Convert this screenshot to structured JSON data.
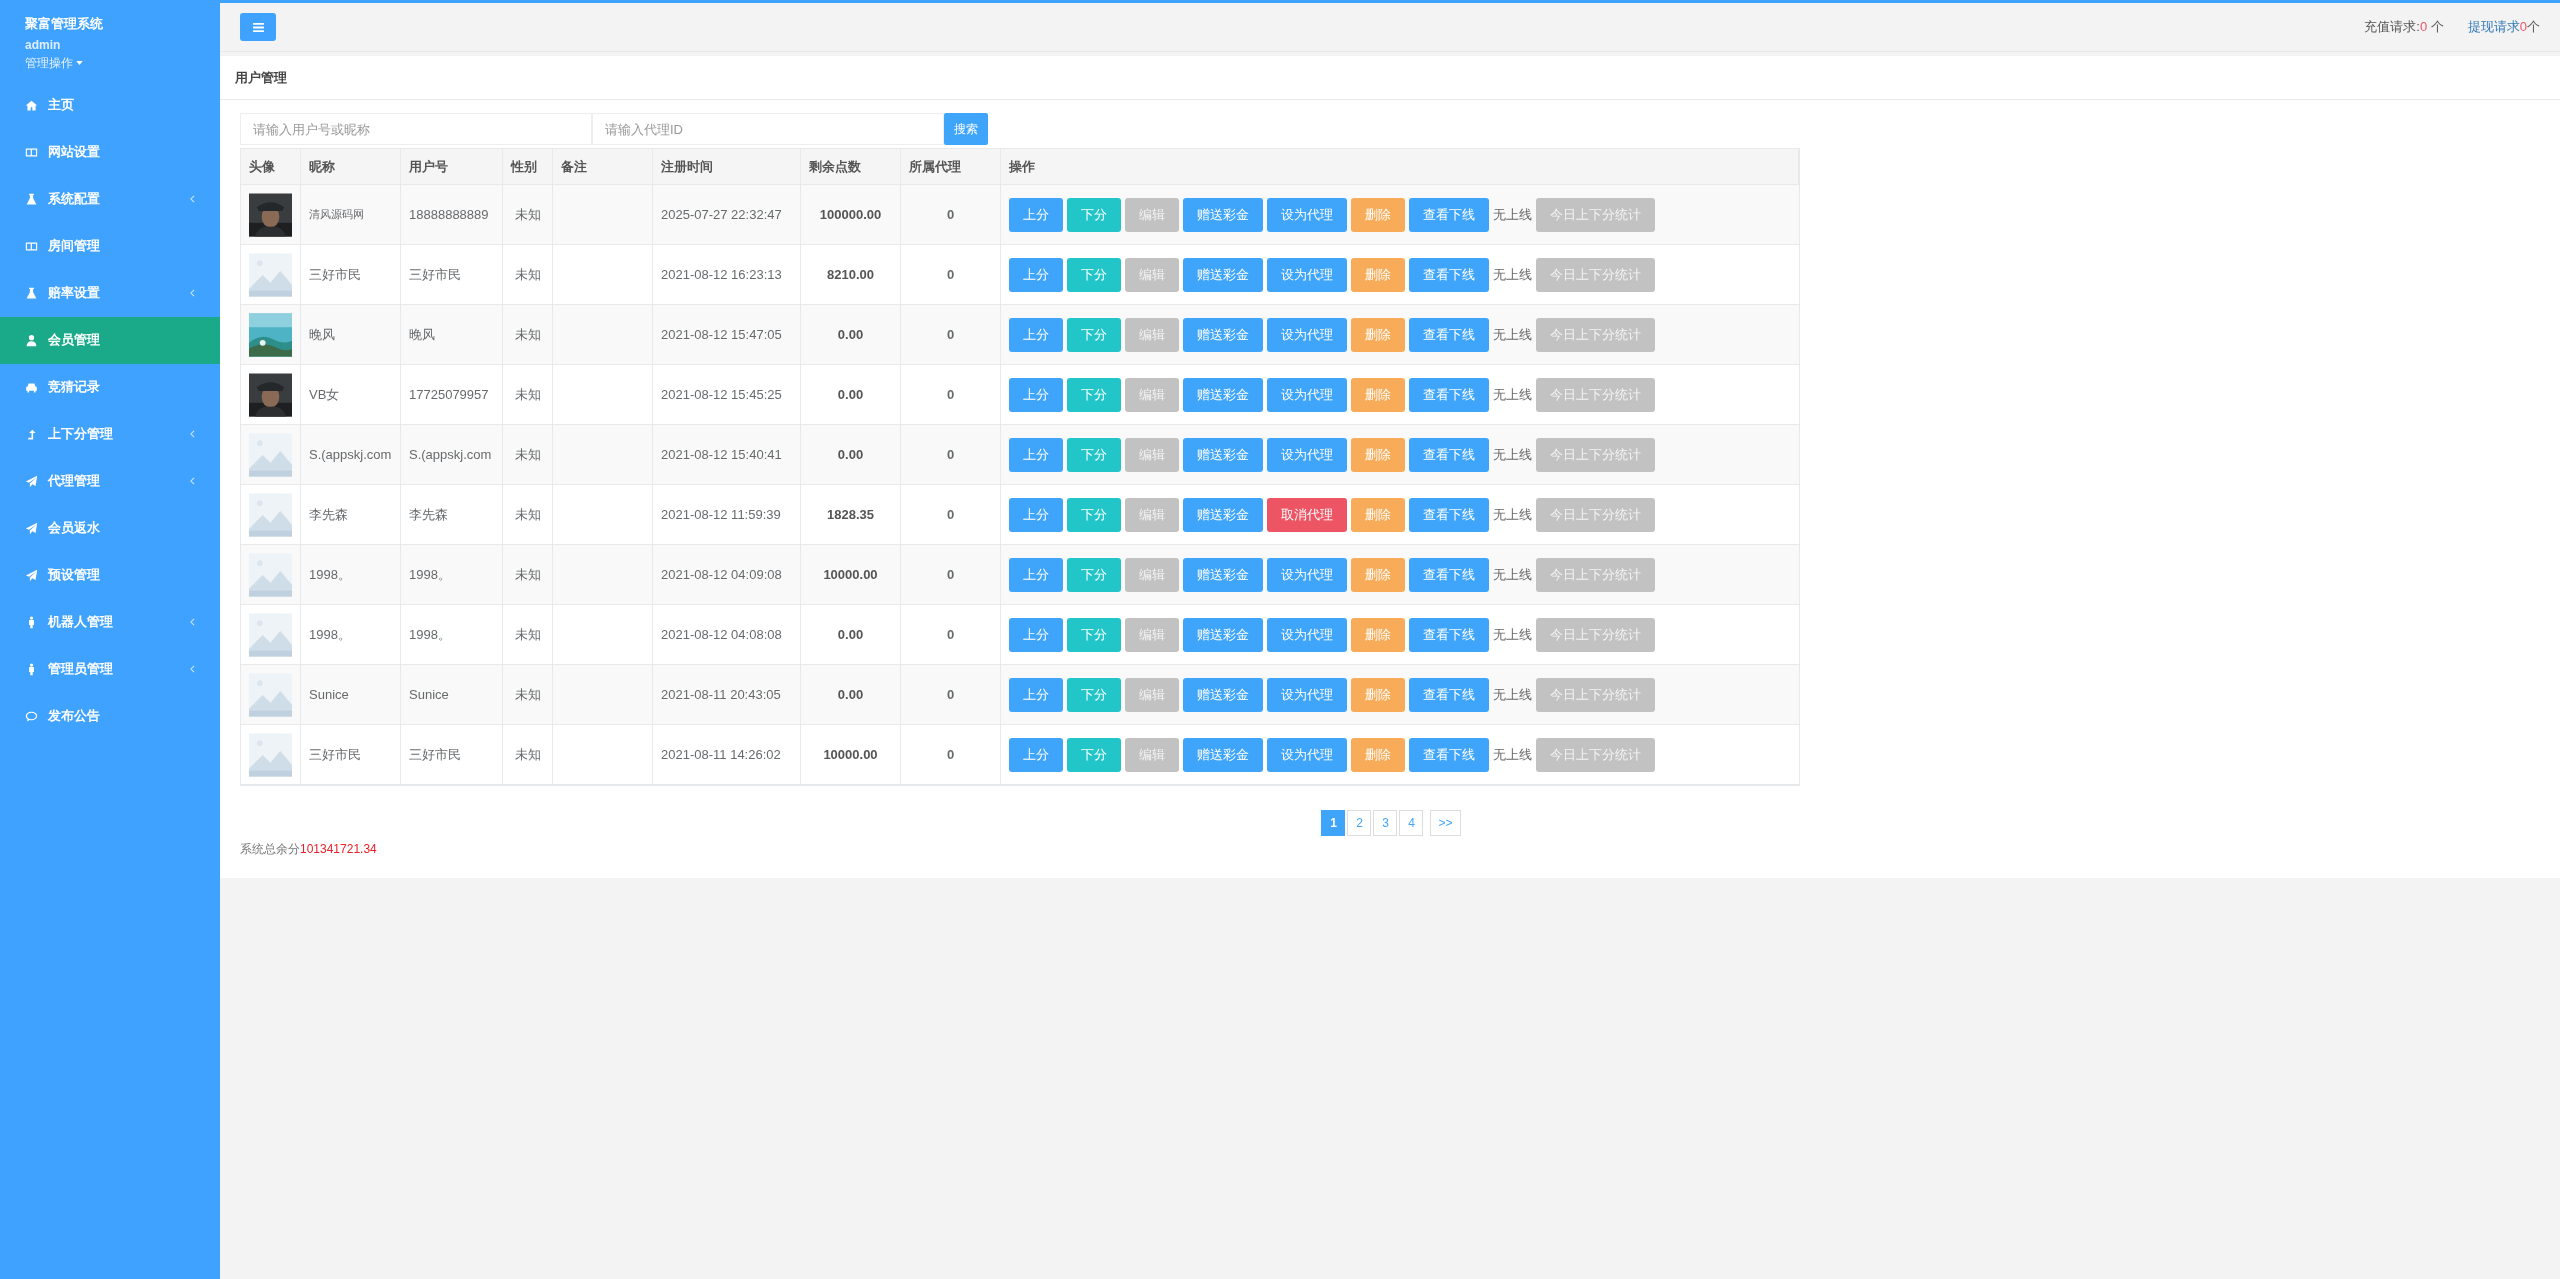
{
  "sidebar": {
    "title": "聚富管理系统",
    "user": "admin",
    "menu_label": "管理操作",
    "items": [
      {
        "label": "主页",
        "selected": false,
        "collapsible": false
      },
      {
        "label": "网站设置",
        "selected": false,
        "collapsible": false
      },
      {
        "label": "系统配置",
        "selected": false,
        "collapsible": true
      },
      {
        "label": "房间管理",
        "selected": false,
        "collapsible": false
      },
      {
        "label": "赔率设置",
        "selected": false,
        "collapsible": true
      },
      {
        "label": "会员管理",
        "selected": true,
        "collapsible": false
      },
      {
        "label": "竞猜记录",
        "selected": false,
        "collapsible": false
      },
      {
        "label": "上下分管理",
        "selected": false,
        "collapsible": true
      },
      {
        "label": "代理管理",
        "selected": false,
        "collapsible": true
      },
      {
        "label": "会员返水",
        "selected": false,
        "collapsible": false
      },
      {
        "label": "预设管理",
        "selected": false,
        "collapsible": false
      },
      {
        "label": "机器人管理",
        "selected": false,
        "collapsible": true
      },
      {
        "label": "管理员管理",
        "selected": false,
        "collapsible": true
      },
      {
        "label": "发布公告",
        "selected": false,
        "collapsible": false
      }
    ]
  },
  "topbar": {
    "requests": [
      {
        "label": "充值请求:",
        "count": "0",
        "unit": " 个",
        "kind": "plain"
      },
      {
        "label": "提现请求 ",
        "count": "0",
        "unit": "个",
        "kind": "link"
      }
    ]
  },
  "page": {
    "title": "用户管理",
    "search": {
      "fields": [
        {
          "placeholder": "请输入用户号或昵称"
        },
        {
          "placeholder": "请输入代理ID"
        }
      ],
      "button": "搜索"
    },
    "table": {
      "columns": [
        "头像",
        "昵称",
        "用户号",
        "性别",
        "备注",
        "注册时间",
        "剩余点数",
        "所属代理",
        "操作"
      ],
      "rows": [
        {
          "avatar": {
            "kind": "portrait"
          },
          "nickname": "清风源码网",
          "user_id": "18888888889",
          "gender": "未知",
          "registered": "2025-07-27 22:32:47",
          "points": "100000.00",
          "agent": "0",
          "actions": [
            {
              "label": "上分",
              "kind": "primary"
            },
            {
              "label": "下分",
              "kind": "info"
            },
            {
              "label": "编辑",
              "kind": "muted"
            },
            {
              "label": "赠送彩金",
              "kind": "primary"
            },
            {
              "label": "设为代理",
              "kind": "primary"
            },
            {
              "label": "删除",
              "kind": "warning"
            },
            {
              "label": "查看下线",
              "kind": "primary"
            },
            {
              "label": "无上线",
              "kind": "text"
            },
            {
              "label": "今日上下分统计",
              "kind": "muted"
            }
          ]
        },
        {
          "avatar": {
            "kind": "placeholder"
          },
          "nickname": "三好市民",
          "user_id": "三好市民",
          "gender": "未知",
          "registered": "2021-08-12 16:23:13",
          "points": "8210.00",
          "agent": "0",
          "actions": [
            {
              "label": "上分",
              "kind": "primary"
            },
            {
              "label": "下分",
              "kind": "info"
            },
            {
              "label": "编辑",
              "kind": "muted"
            },
            {
              "label": "赠送彩金",
              "kind": "primary"
            },
            {
              "label": "设为代理",
              "kind": "primary"
            },
            {
              "label": "删除",
              "kind": "warning"
            },
            {
              "label": "查看下线",
              "kind": "primary"
            },
            {
              "label": "无上线",
              "kind": "text"
            },
            {
              "label": "今日上下分统计",
              "kind": "muted"
            }
          ]
        },
        {
          "avatar": {
            "kind": "landscape"
          },
          "nickname": "晚风",
          "user_id": "晚风",
          "gender": "未知",
          "registered": "2021-08-12 15:47:05",
          "points": "0.00",
          "agent": "0",
          "actions": [
            {
              "label": "上分",
              "kind": "primary"
            },
            {
              "label": "下分",
              "kind": "info"
            },
            {
              "label": "编辑",
              "kind": "muted"
            },
            {
              "label": "赠送彩金",
              "kind": "primary"
            },
            {
              "label": "设为代理",
              "kind": "primary"
            },
            {
              "label": "删除",
              "kind": "warning"
            },
            {
              "label": "查看下线",
              "kind": "primary"
            },
            {
              "label": "无上线",
              "kind": "text"
            },
            {
              "label": "今日上下分统计",
              "kind": "muted"
            }
          ]
        },
        {
          "avatar": {
            "kind": "portrait"
          },
          "nickname": "VB女",
          "user_id": "17725079957",
          "gender": "未知",
          "registered": "2021-08-12 15:45:25",
          "points": "0.00",
          "agent": "0",
          "actions": [
            {
              "label": "上分",
              "kind": "primary"
            },
            {
              "label": "下分",
              "kind": "info"
            },
            {
              "label": "编辑",
              "kind": "muted"
            },
            {
              "label": "赠送彩金",
              "kind": "primary"
            },
            {
              "label": "设为代理",
              "kind": "primary"
            },
            {
              "label": "删除",
              "kind": "warning"
            },
            {
              "label": "查看下线",
              "kind": "primary"
            },
            {
              "label": "无上线",
              "kind": "text"
            },
            {
              "label": "今日上下分统计",
              "kind": "muted"
            }
          ]
        },
        {
          "avatar": {
            "kind": "placeholder"
          },
          "nickname": "S.(appskj.com",
          "user_id": "S.(appskj.com",
          "gender": "未知",
          "registered": "2021-08-12 15:40:41",
          "points": "0.00",
          "agent": "0",
          "actions": [
            {
              "label": "上分",
              "kind": "primary"
            },
            {
              "label": "下分",
              "kind": "info"
            },
            {
              "label": "编辑",
              "kind": "muted"
            },
            {
              "label": "赠送彩金",
              "kind": "primary"
            },
            {
              "label": "设为代理",
              "kind": "primary"
            },
            {
              "label": "删除",
              "kind": "warning"
            },
            {
              "label": "查看下线",
              "kind": "primary"
            },
            {
              "label": "无上线",
              "kind": "text"
            },
            {
              "label": "今日上下分统计",
              "kind": "muted"
            }
          ]
        },
        {
          "avatar": {
            "kind": "placeholder"
          },
          "nickname": "李先森",
          "user_id": "李先森",
          "gender": "未知",
          "registered": "2021-08-12 11:59:39",
          "points": "1828.35",
          "agent": "0",
          "actions": [
            {
              "label": "上分",
              "kind": "primary"
            },
            {
              "label": "下分",
              "kind": "info"
            },
            {
              "label": "编辑",
              "kind": "muted"
            },
            {
              "label": "赠送彩金",
              "kind": "primary"
            },
            {
              "label": "取消代理",
              "kind": "danger"
            },
            {
              "label": "删除",
              "kind": "warning"
            },
            {
              "label": "查看下线",
              "kind": "primary"
            },
            {
              "label": "无上线",
              "kind": "text"
            },
            {
              "label": "今日上下分统计",
              "kind": "muted"
            }
          ]
        },
        {
          "avatar": {
            "kind": "placeholder"
          },
          "nickname": "1998。",
          "user_id": "1998。",
          "gender": "未知",
          "registered": "2021-08-12 04:09:08",
          "points": "10000.00",
          "agent": "0",
          "actions": [
            {
              "label": "上分",
              "kind": "primary"
            },
            {
              "label": "下分",
              "kind": "info"
            },
            {
              "label": "编辑",
              "kind": "muted"
            },
            {
              "label": "赠送彩金",
              "kind": "primary"
            },
            {
              "label": "设为代理",
              "kind": "primary"
            },
            {
              "label": "删除",
              "kind": "warning"
            },
            {
              "label": "查看下线",
              "kind": "primary"
            },
            {
              "label": "无上线",
              "kind": "text"
            },
            {
              "label": "今日上下分统计",
              "kind": "muted"
            }
          ]
        },
        {
          "avatar": {
            "kind": "placeholder"
          },
          "nickname": "1998。",
          "user_id": "1998。",
          "gender": "未知",
          "registered": "2021-08-12 04:08:08",
          "points": "0.00",
          "agent": "0",
          "actions": [
            {
              "label": "上分",
              "kind": "primary"
            },
            {
              "label": "下分",
              "kind": "info"
            },
            {
              "label": "编辑",
              "kind": "muted"
            },
            {
              "label": "赠送彩金",
              "kind": "primary"
            },
            {
              "label": "设为代理",
              "kind": "primary"
            },
            {
              "label": "删除",
              "kind": "warning"
            },
            {
              "label": "查看下线",
              "kind": "primary"
            },
            {
              "label": "无上线",
              "kind": "text"
            },
            {
              "label": "今日上下分统计",
              "kind": "muted"
            }
          ]
        },
        {
          "avatar": {
            "kind": "placeholder"
          },
          "nickname": "Sunice",
          "user_id": "Sunice",
          "gender": "未知",
          "registered": "2021-08-11 20:43:05",
          "points": "0.00",
          "agent": "0",
          "actions": [
            {
              "label": "上分",
              "kind": "primary"
            },
            {
              "label": "下分",
              "kind": "info"
            },
            {
              "label": "编辑",
              "kind": "muted"
            },
            {
              "label": "赠送彩金",
              "kind": "primary"
            },
            {
              "label": "设为代理",
              "kind": "primary"
            },
            {
              "label": "删除",
              "kind": "warning"
            },
            {
              "label": "查看下线",
              "kind": "primary"
            },
            {
              "label": "无上线",
              "kind": "text"
            },
            {
              "label": "今日上下分统计",
              "kind": "muted"
            }
          ]
        },
        {
          "avatar": {
            "kind": "placeholder"
          },
          "nickname": "三好市民",
          "user_id": "三好市民",
          "gender": "未知",
          "registered": "2021-08-11 14:26:02",
          "points": "10000.00",
          "agent": "0",
          "actions": [
            {
              "label": "上分",
              "kind": "primary"
            },
            {
              "label": "下分",
              "kind": "info"
            },
            {
              "label": "编辑",
              "kind": "muted"
            },
            {
              "label": "赠送彩金",
              "kind": "primary"
            },
            {
              "label": "设为代理",
              "kind": "primary"
            },
            {
              "label": "删除",
              "kind": "warning"
            },
            {
              "label": "查看下线",
              "kind": "primary"
            },
            {
              "label": "无上线",
              "kind": "text"
            },
            {
              "label": "今日上下分统计",
              "kind": "muted"
            }
          ]
        }
      ]
    },
    "pagination": [
      {
        "label": "1",
        "selected": true
      },
      {
        "label": "2",
        "selected": false
      },
      {
        "label": "3",
        "selected": false
      },
      {
        "label": "4",
        "selected": false
      },
      {
        "label": ">>",
        "selected": false
      }
    ],
    "total": {
      "label": "系统总余分",
      "value": "101341721.34"
    }
  }
}
